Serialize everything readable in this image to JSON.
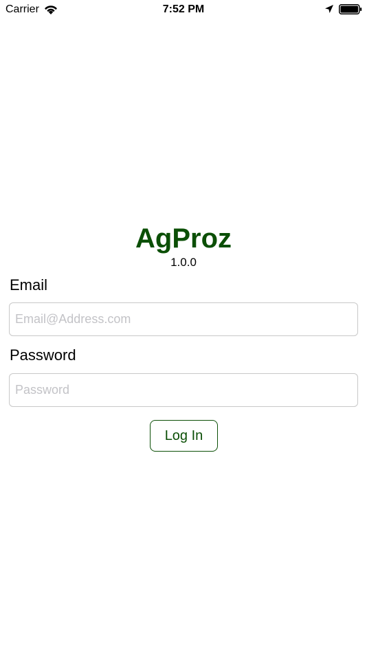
{
  "status_bar": {
    "carrier": "Carrier",
    "time": "7:52 PM",
    "icons": [
      "wifi-icon",
      "location-arrow-icon",
      "battery-icon"
    ]
  },
  "app": {
    "title": "AgProz",
    "version": "1.0.0"
  },
  "login_form": {
    "email_label": "Email",
    "email_placeholder": "Email@Address.com",
    "email_value": "",
    "password_label": "Password",
    "password_placeholder": "Password",
    "password_value": "",
    "login_button_label": "Log In"
  },
  "colors": {
    "brand_green": "#0b4f06",
    "input_border": "#c8c8c8",
    "placeholder": "#c3c3c7"
  }
}
